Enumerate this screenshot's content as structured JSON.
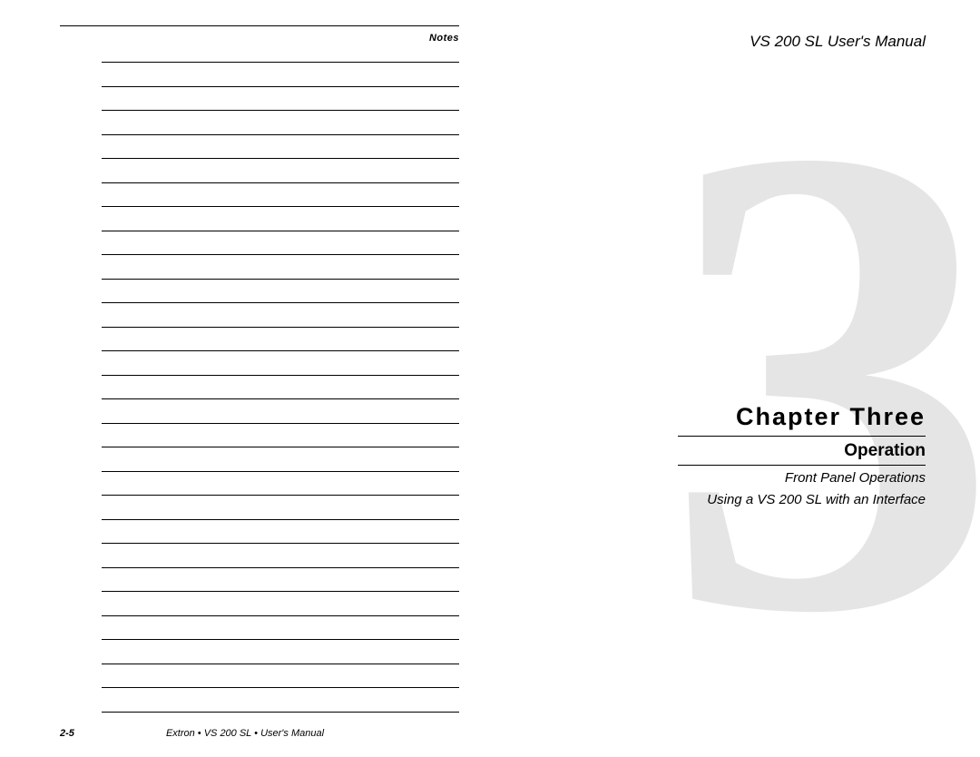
{
  "left_page": {
    "header_label": "Notes",
    "page_number": "2-5",
    "footer": "Extron • VS 200 SL • User's Manual",
    "note_line_count": 28
  },
  "right_page": {
    "manual_title": "VS 200 SL User's Manual",
    "big_digit": "3",
    "chapter_line": "Chapter Three",
    "section_title": "Operation",
    "subsection_1": "Front Panel Operations",
    "subsection_2": "Using a VS 200 SL with an Interface"
  }
}
